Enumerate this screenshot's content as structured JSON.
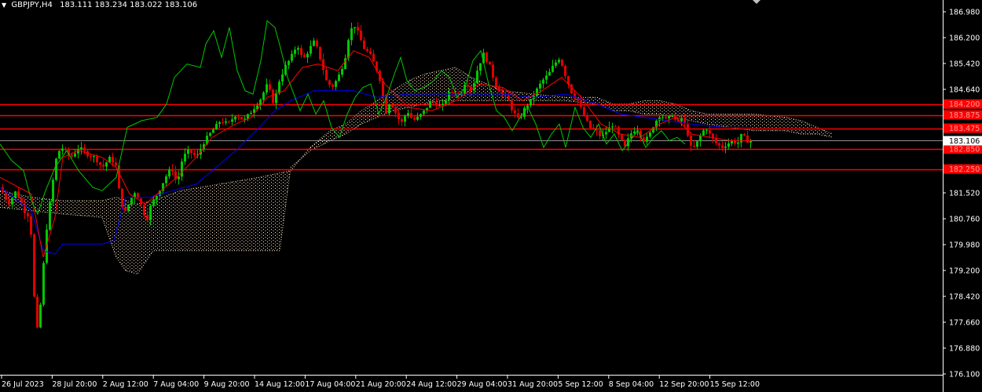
{
  "header": {
    "symbol": "GBPJPY,H4",
    "ohlc": "183.111 183.234 183.022 183.106",
    "menu_icon": "triangle-down-icon"
  },
  "colors": {
    "background": "#000000",
    "axis": "#ffffff",
    "bull": "#00c800",
    "bear": "#e00000",
    "level": "#ff0000",
    "tenkan": "#ff0000",
    "kijun": "#0000ff",
    "chikou": "#00c800",
    "cloud": "#ffe4c4",
    "current": "#ffffff"
  },
  "chart_data": {
    "type": "candlestick",
    "price_axis": {
      "min": 176.1,
      "max": 186.97,
      "ticks": [
        "186.980",
        "186.200",
        "185.420",
        "184.640",
        "183.860",
        "183.080",
        "182.300",
        "181.520",
        "180.760",
        "179.980",
        "179.200",
        "178.420",
        "177.660",
        "176.880",
        "176.100"
      ]
    },
    "time_labels": [
      "26 Jul 2023",
      "28 Jul 20:00",
      "2 Aug 12:00",
      "7 Aug 04:00",
      "9 Aug 20:00",
      "14 Aug 12:00",
      "17 Aug 04:00",
      "21 Aug 20:00",
      "24 Aug 12:00",
      "29 Aug 04:00",
      "31 Aug 20:00",
      "5 Sep 12:00",
      "8 Sep 04:00",
      "12 Sep 20:00",
      "15 Sep 12:00"
    ],
    "levels": [
      {
        "price": 184.2,
        "label": "184.200"
      },
      {
        "price": 183.875,
        "label": "183.875"
      },
      {
        "price": 183.475,
        "label": "183.475"
      },
      {
        "price": 182.85,
        "label": "182.850"
      },
      {
        "price": 182.25,
        "label": "182.250"
      }
    ],
    "current_price": {
      "price": 183.106,
      "label": "183.106"
    },
    "price_path": [
      [
        0,
        181.7
      ],
      [
        10,
        181.2
      ],
      [
        20,
        181.6
      ],
      [
        30,
        181.0
      ],
      [
        38,
        180.8
      ],
      [
        43,
        178.4
      ],
      [
        48,
        177.2
      ],
      [
        52,
        178.5
      ],
      [
        58,
        180.3
      ],
      [
        65,
        181.6
      ],
      [
        72,
        182.7
      ],
      [
        78,
        182.9
      ],
      [
        90,
        182.6
      ],
      [
        100,
        182.9
      ],
      [
        110,
        182.7
      ],
      [
        120,
        182.6
      ],
      [
        130,
        182.3
      ],
      [
        140,
        182.6
      ],
      [
        148,
        182.3
      ],
      [
        152,
        181.4
      ],
      [
        158,
        180.9
      ],
      [
        165,
        181.3
      ],
      [
        172,
        181.6
      ],
      [
        180,
        181.1
      ],
      [
        186,
        180.7
      ],
      [
        192,
        181.2
      ],
      [
        200,
        181.5
      ],
      [
        210,
        182.0
      ],
      [
        218,
        182.3
      ],
      [
        225,
        181.8
      ],
      [
        232,
        182.6
      ],
      [
        240,
        182.8
      ],
      [
        250,
        182.6
      ],
      [
        260,
        183.1
      ],
      [
        270,
        183.4
      ],
      [
        280,
        183.7
      ],
      [
        290,
        183.6
      ],
      [
        300,
        183.9
      ],
      [
        310,
        183.7
      ],
      [
        320,
        184.0
      ],
      [
        330,
        184.3
      ],
      [
        340,
        184.8
      ],
      [
        348,
        184.2
      ],
      [
        355,
        184.9
      ],
      [
        362,
        185.3
      ],
      [
        370,
        185.6
      ],
      [
        378,
        186.0
      ],
      [
        385,
        185.5
      ],
      [
        392,
        185.8
      ],
      [
        400,
        186.1
      ],
      [
        408,
        185.5
      ],
      [
        415,
        184.9
      ],
      [
        422,
        184.7
      ],
      [
        430,
        185.0
      ],
      [
        438,
        185.5
      ],
      [
        444,
        186.3
      ],
      [
        450,
        186.6
      ],
      [
        456,
        186.3
      ],
      [
        462,
        185.9
      ],
      [
        470,
        185.7
      ],
      [
        478,
        185.3
      ],
      [
        485,
        184.8
      ],
      [
        490,
        183.9
      ],
      [
        496,
        184.3
      ],
      [
        502,
        184.0
      ],
      [
        510,
        183.6
      ],
      [
        518,
        184.0
      ],
      [
        525,
        183.7
      ],
      [
        532,
        183.8
      ],
      [
        540,
        184.0
      ],
      [
        548,
        184.3
      ],
      [
        555,
        184.2
      ],
      [
        562,
        184.1
      ],
      [
        570,
        184.5
      ],
      [
        578,
        184.6
      ],
      [
        585,
        184.4
      ],
      [
        592,
        184.9
      ],
      [
        600,
        184.6
      ],
      [
        608,
        185.3
      ],
      [
        615,
        185.7
      ],
      [
        622,
        185.4
      ],
      [
        630,
        184.8
      ],
      [
        638,
        184.5
      ],
      [
        645,
        184.4
      ],
      [
        652,
        184.0
      ],
      [
        660,
        183.7
      ],
      [
        668,
        184.1
      ],
      [
        675,
        184.3
      ],
      [
        682,
        184.6
      ],
      [
        690,
        184.9
      ],
      [
        698,
        185.1
      ],
      [
        705,
        185.4
      ],
      [
        712,
        185.6
      ],
      [
        720,
        185.0
      ],
      [
        728,
        184.5
      ],
      [
        735,
        184.3
      ],
      [
        742,
        183.9
      ],
      [
        750,
        183.5
      ],
      [
        758,
        183.4
      ],
      [
        765,
        183.2
      ],
      [
        772,
        183.4
      ],
      [
        780,
        183.6
      ],
      [
        788,
        183.2
      ],
      [
        795,
        182.9
      ],
      [
        802,
        183.3
      ],
      [
        810,
        183.5
      ],
      [
        818,
        183.1
      ],
      [
        825,
        183.2
      ],
      [
        832,
        183.6
      ],
      [
        840,
        183.9
      ],
      [
        848,
        183.7
      ],
      [
        855,
        183.9
      ],
      [
        862,
        183.6
      ],
      [
        868,
        183.8
      ],
      [
        875,
        183.3
      ],
      [
        880,
        182.8
      ],
      [
        886,
        183.0
      ],
      [
        892,
        183.3
      ],
      [
        898,
        183.5
      ],
      [
        905,
        183.2
      ],
      [
        912,
        183.0
      ],
      [
        918,
        182.9
      ],
      [
        925,
        183.0
      ],
      [
        932,
        183.1
      ],
      [
        938,
        183.0
      ],
      [
        944,
        183.3
      ],
      [
        950,
        183.1
      ],
      [
        956,
        183.106
      ]
    ],
    "tenkan_path": [
      [
        0,
        182.0
      ],
      [
        40,
        181.5
      ],
      [
        55,
        179.6
      ],
      [
        70,
        180.8
      ],
      [
        80,
        182.6
      ],
      [
        100,
        182.8
      ],
      [
        130,
        182.6
      ],
      [
        148,
        182.3
      ],
      [
        165,
        181.5
      ],
      [
        185,
        181.2
      ],
      [
        205,
        181.6
      ],
      [
        225,
        182.0
      ],
      [
        250,
        182.6
      ],
      [
        270,
        183.2
      ],
      [
        300,
        183.6
      ],
      [
        320,
        183.8
      ],
      [
        340,
        184.4
      ],
      [
        362,
        184.6
      ],
      [
        385,
        185.3
      ],
      [
        405,
        185.4
      ],
      [
        430,
        185.2
      ],
      [
        450,
        185.8
      ],
      [
        470,
        185.6
      ],
      [
        490,
        184.8
      ],
      [
        520,
        184.1
      ],
      [
        550,
        184.0
      ],
      [
        580,
        184.3
      ],
      [
        610,
        184.8
      ],
      [
        640,
        184.7
      ],
      [
        665,
        184.3
      ],
      [
        690,
        184.6
      ],
      [
        715,
        185.0
      ],
      [
        740,
        184.4
      ],
      [
        765,
        183.6
      ],
      [
        790,
        183.3
      ],
      [
        815,
        183.2
      ],
      [
        840,
        183.6
      ],
      [
        860,
        183.8
      ],
      [
        880,
        183.3
      ],
      [
        905,
        183.2
      ],
      [
        930,
        183.1
      ],
      [
        956,
        183.1
      ]
    ],
    "kijun_path": [
      [
        0,
        181.7
      ],
      [
        40,
        181.0
      ],
      [
        55,
        179.8
      ],
      [
        70,
        179.7
      ],
      [
        80,
        180.0
      ],
      [
        130,
        180.0
      ],
      [
        145,
        180.1
      ],
      [
        160,
        181.4
      ],
      [
        190,
        181.4
      ],
      [
        220,
        181.6
      ],
      [
        250,
        181.8
      ],
      [
        275,
        182.3
      ],
      [
        300,
        182.8
      ],
      [
        330,
        183.5
      ],
      [
        350,
        184.0
      ],
      [
        370,
        184.3
      ],
      [
        400,
        184.6
      ],
      [
        420,
        184.6
      ],
      [
        450,
        184.6
      ],
      [
        480,
        184.4
      ],
      [
        520,
        184.5
      ],
      [
        560,
        184.5
      ],
      [
        600,
        184.5
      ],
      [
        640,
        184.5
      ],
      [
        680,
        184.4
      ],
      [
        720,
        184.5
      ],
      [
        760,
        184.2
      ],
      [
        790,
        183.9
      ],
      [
        820,
        183.8
      ],
      [
        850,
        183.7
      ],
      [
        880,
        183.6
      ],
      [
        920,
        183.5
      ],
      [
        956,
        183.5
      ]
    ],
    "chikou_path": [
      [
        0,
        183.0
      ],
      [
        15,
        182.5
      ],
      [
        30,
        182.2
      ],
      [
        40,
        181.3
      ],
      [
        48,
        180.9
      ],
      [
        58,
        181.6
      ],
      [
        70,
        182.3
      ],
      [
        85,
        182.8
      ],
      [
        100,
        182.2
      ],
      [
        118,
        181.7
      ],
      [
        130,
        181.6
      ],
      [
        148,
        182.0
      ],
      [
        162,
        183.5
      ],
      [
        180,
        183.7
      ],
      [
        200,
        183.8
      ],
      [
        212,
        184.2
      ],
      [
        222,
        185.0
      ],
      [
        238,
        185.4
      ],
      [
        255,
        185.3
      ],
      [
        262,
        186.0
      ],
      [
        272,
        186.4
      ],
      [
        282,
        185.6
      ],
      [
        292,
        186.5
      ],
      [
        302,
        185.2
      ],
      [
        312,
        184.6
      ],
      [
        322,
        184.5
      ],
      [
        332,
        185.5
      ],
      [
        340,
        186.7
      ],
      [
        350,
        186.5
      ],
      [
        358,
        185.8
      ],
      [
        366,
        185.0
      ],
      [
        374,
        184.5
      ],
      [
        382,
        184.0
      ],
      [
        392,
        184.5
      ],
      [
        402,
        183.9
      ],
      [
        412,
        184.3
      ],
      [
        422,
        183.5
      ],
      [
        432,
        183.2
      ],
      [
        442,
        183.9
      ],
      [
        452,
        184.4
      ],
      [
        462,
        184.7
      ],
      [
        472,
        184.8
      ],
      [
        482,
        183.9
      ],
      [
        492,
        184.4
      ],
      [
        502,
        185.1
      ],
      [
        510,
        185.6
      ],
      [
        518,
        184.9
      ],
      [
        528,
        184.6
      ],
      [
        540,
        184.7
      ],
      [
        552,
        184.9
      ],
      [
        562,
        185.2
      ],
      [
        572,
        185.0
      ],
      [
        582,
        184.4
      ],
      [
        592,
        184.7
      ],
      [
        602,
        185.5
      ],
      [
        612,
        185.8
      ],
      [
        622,
        184.8
      ],
      [
        632,
        184.0
      ],
      [
        642,
        183.8
      ],
      [
        652,
        183.4
      ],
      [
        662,
        183.8
      ],
      [
        672,
        184.1
      ],
      [
        682,
        183.6
      ],
      [
        692,
        182.9
      ],
      [
        702,
        183.3
      ],
      [
        712,
        183.6
      ],
      [
        720,
        182.9
      ],
      [
        732,
        184.1
      ],
      [
        742,
        183.5
      ],
      [
        752,
        183.2
      ],
      [
        762,
        183.6
      ],
      [
        772,
        183.0
      ],
      [
        782,
        183.3
      ],
      [
        792,
        182.8
      ],
      [
        802,
        183.1
      ],
      [
        812,
        183.4
      ],
      [
        822,
        182.9
      ],
      [
        832,
        183.2
      ],
      [
        842,
        183.4
      ],
      [
        852,
        183.1
      ],
      [
        862,
        183.2
      ],
      [
        872,
        183.0
      ]
    ],
    "cloud_top": [
      [
        0,
        181.6
      ],
      [
        40,
        181.4
      ],
      [
        80,
        181.3
      ],
      [
        130,
        181.3
      ],
      [
        148,
        181.4
      ],
      [
        175,
        181.2
      ],
      [
        195,
        181.3
      ],
      [
        230,
        181.6
      ],
      [
        280,
        181.8
      ],
      [
        330,
        182.0
      ],
      [
        370,
        182.2
      ],
      [
        395,
        182.9
      ],
      [
        420,
        183.4
      ],
      [
        440,
        183.6
      ],
      [
        460,
        184.0
      ],
      [
        480,
        184.3
      ],
      [
        500,
        184.6
      ],
      [
        520,
        184.9
      ],
      [
        540,
        185.1
      ],
      [
        560,
        185.2
      ],
      [
        580,
        185.3
      ],
      [
        600,
        185.0
      ],
      [
        620,
        184.8
      ],
      [
        640,
        184.6
      ],
      [
        680,
        184.5
      ],
      [
        720,
        184.4
      ],
      [
        760,
        184.4
      ],
      [
        780,
        184.2
      ],
      [
        800,
        184.2
      ],
      [
        820,
        184.3
      ],
      [
        840,
        184.3
      ],
      [
        860,
        184.2
      ],
      [
        880,
        184.0
      ],
      [
        900,
        183.9
      ],
      [
        930,
        183.9
      ],
      [
        960,
        183.9
      ],
      [
        1000,
        183.8
      ],
      [
        1020,
        183.7
      ],
      [
        1040,
        183.5
      ],
      [
        1060,
        183.3
      ]
    ],
    "cloud_bottom": [
      [
        0,
        181.1
      ],
      [
        40,
        181.0
      ],
      [
        80,
        180.9
      ],
      [
        130,
        180.8
      ],
      [
        148,
        179.6
      ],
      [
        160,
        179.2
      ],
      [
        175,
        179.1
      ],
      [
        195,
        179.8
      ],
      [
        230,
        179.8
      ],
      [
        280,
        179.8
      ],
      [
        330,
        179.8
      ],
      [
        356,
        179.8
      ],
      [
        370,
        182.3
      ],
      [
        395,
        182.8
      ],
      [
        420,
        183.1
      ],
      [
        440,
        183.3
      ],
      [
        460,
        183.6
      ],
      [
        480,
        183.8
      ],
      [
        500,
        184.0
      ],
      [
        520,
        184.1
      ],
      [
        540,
        184.2
      ],
      [
        560,
        184.3
      ],
      [
        580,
        184.3
      ],
      [
        600,
        184.3
      ],
      [
        620,
        184.3
      ],
      [
        640,
        184.3
      ],
      [
        680,
        184.3
      ],
      [
        720,
        184.3
      ],
      [
        760,
        184.2
      ],
      [
        780,
        184.0
      ],
      [
        800,
        184.0
      ],
      [
        820,
        183.9
      ],
      [
        840,
        183.9
      ],
      [
        860,
        183.8
      ],
      [
        880,
        183.7
      ],
      [
        900,
        183.6
      ],
      [
        930,
        183.5
      ],
      [
        960,
        183.4
      ],
      [
        1000,
        183.4
      ],
      [
        1020,
        183.3
      ],
      [
        1040,
        183.3
      ],
      [
        1060,
        183.2
      ]
    ]
  }
}
